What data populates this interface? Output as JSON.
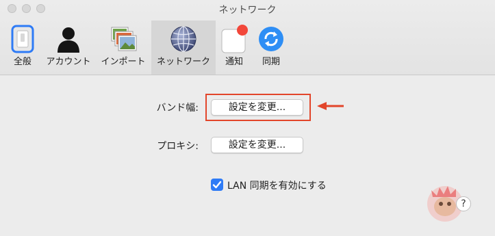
{
  "window": {
    "title": "ネットワーク"
  },
  "toolbar": {
    "tabs": [
      {
        "label": "全般",
        "icon": "switch-icon"
      },
      {
        "label": "アカウント",
        "icon": "person-icon"
      },
      {
        "label": "インポート",
        "icon": "photos-icon"
      },
      {
        "label": "ネットワーク",
        "icon": "globe-icon",
        "active": true
      },
      {
        "label": "通知",
        "icon": "notification-icon"
      },
      {
        "label": "同期",
        "icon": "sync-icon"
      }
    ]
  },
  "settings": {
    "bandwidth_label": "バンド幅:",
    "bandwidth_button": "設定を変更...",
    "proxy_label": "プロキシ:",
    "proxy_button": "設定を変更...",
    "lan_sync_label": "LAN 同期を有効にする",
    "lan_sync_checked": true
  },
  "help": {
    "label": "?"
  },
  "colors": {
    "accent": "#2e7bf6",
    "highlight": "#e2452a",
    "notification_badge": "#f2473a"
  }
}
